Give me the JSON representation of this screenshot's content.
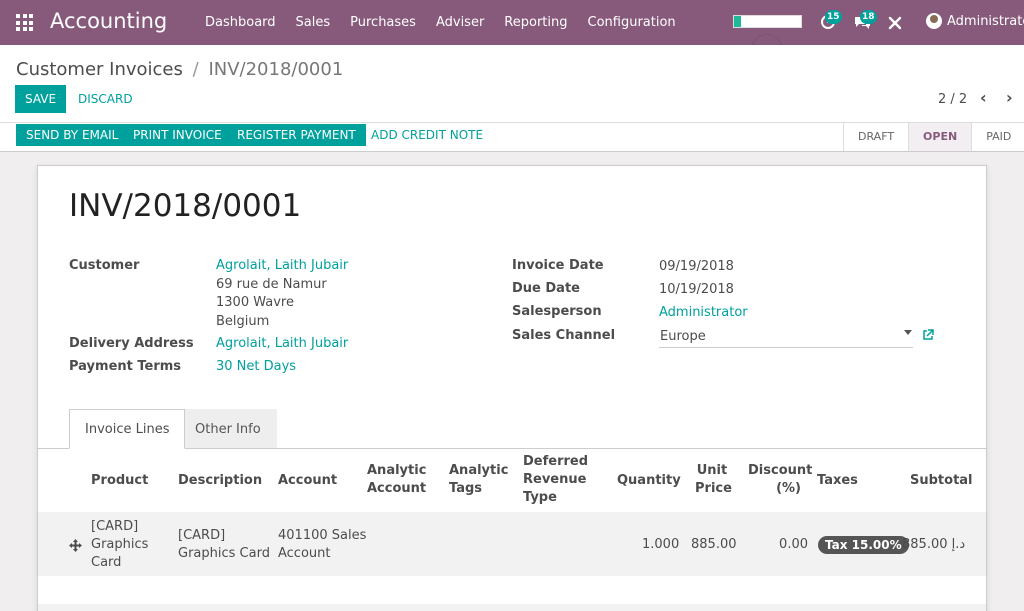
{
  "navbar": {
    "app_name": "Accounting",
    "menu": [
      "Dashboard",
      "Sales",
      "Purchases",
      "Adviser",
      "Reporting",
      "Configuration"
    ],
    "activity_count": "15",
    "messages_count": "18",
    "user": "Administrator",
    "progress_percent": 10
  },
  "breadcrumb": {
    "parent": "Customer Invoices",
    "separator": "/",
    "current": "INV/2018/0001"
  },
  "actions": {
    "save": "SAVE",
    "discard": "DISCARD"
  },
  "pager": {
    "value": "2 / 2"
  },
  "statusbar": {
    "buttons": [
      "SEND BY EMAIL",
      "PRINT INVOICE",
      "REGISTER PAYMENT"
    ],
    "link": "ADD CREDIT NOTE",
    "states": [
      "DRAFT",
      "OPEN",
      "PAID"
    ],
    "active_state": "OPEN"
  },
  "invoice": {
    "number": "INV/2018/0001",
    "customer_label": "Customer",
    "customer": "Agrolait, Laith Jubair",
    "address_lines": [
      "69 rue de Namur",
      "1300 Wavre",
      "Belgium"
    ],
    "delivery_label": "Delivery Address",
    "delivery": "Agrolait, Laith Jubair",
    "terms_label": "Payment Terms",
    "terms": "30 Net Days",
    "date_label": "Invoice Date",
    "date": "09/19/2018",
    "due_label": "Due Date",
    "due": "10/19/2018",
    "salesperson_label": "Salesperson",
    "salesperson": "Administrator",
    "channel_label": "Sales Channel",
    "channel": "Europe"
  },
  "tabs": [
    "Invoice Lines",
    "Other Info"
  ],
  "table": {
    "headers": {
      "product": "Product",
      "description": "Description",
      "account": "Account",
      "analytic_account": [
        "Analytic",
        "Account"
      ],
      "analytic_tags": [
        "Analytic",
        "Tags"
      ],
      "deferred": [
        "Deferred",
        "Revenue",
        "Type"
      ],
      "quantity": "Quantity",
      "unit_price": [
        "Unit",
        "Price"
      ],
      "discount": [
        "Discount",
        "(%)"
      ],
      "taxes": "Taxes",
      "subtotal": "Subtotal"
    },
    "rows": [
      {
        "product": [
          "[CARD]",
          "Graphics",
          "Card"
        ],
        "description": [
          "[CARD]",
          "Graphics Card"
        ],
        "account": [
          "401100 Sales",
          "Account"
        ],
        "quantity": "1.000",
        "unit_price": "885.00",
        "discount": "0.00",
        "tax": "Tax 15.00%",
        "subtotal": "885.00 د.إ"
      }
    ]
  },
  "colors": {
    "brand": "#875a7b",
    "accent": "#00a09d"
  }
}
